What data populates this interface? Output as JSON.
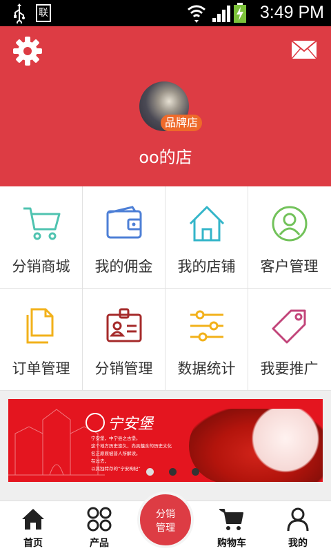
{
  "status_bar": {
    "time": "3:49 PM",
    "sim_label": "联"
  },
  "header": {
    "badge": "品牌店",
    "shop_name": "oo的店"
  },
  "grid": [
    {
      "label": "分销商城",
      "icon": "shopping-cart-icon",
      "color": "#4fc3b0"
    },
    {
      "label": "我的佣金",
      "icon": "wallet-icon",
      "color": "#4d7fd6"
    },
    {
      "label": "我的店铺",
      "icon": "home-icon",
      "color": "#33b5c9"
    },
    {
      "label": "客户管理",
      "icon": "user-circle-icon",
      "color": "#72c25a"
    },
    {
      "label": "订单管理",
      "icon": "documents-icon",
      "color": "#f2b11a"
    },
    {
      "label": "分销管理",
      "icon": "id-card-icon",
      "color": "#a52a2a"
    },
    {
      "label": "数据统计",
      "icon": "sliders-icon",
      "color": "#f2b11a"
    },
    {
      "label": "我要推广",
      "icon": "tag-icon",
      "color": "#c2457a"
    }
  ],
  "banner": {
    "brand": "宁安堡",
    "text_lines": [
      "宁安堡，中宁县之古堡。",
      "这个地方历史悠久，尚具蕴含的历史文化",
      "名正原原被普人所解读。",
      "在过去，",
      "以其独特存的“宁安枸杞”"
    ]
  },
  "tabbar": {
    "items": [
      {
        "label": "首页",
        "icon": "home-icon"
      },
      {
        "label": "产品",
        "icon": "grid-circles-icon"
      },
      {
        "label": "购物车",
        "icon": "cart-icon"
      },
      {
        "label": "我的",
        "icon": "person-icon"
      }
    ],
    "center_line1": "分销",
    "center_line2": "管理"
  },
  "colors": {
    "header": "#dd3c44",
    "badge": "#ee6a2a"
  }
}
